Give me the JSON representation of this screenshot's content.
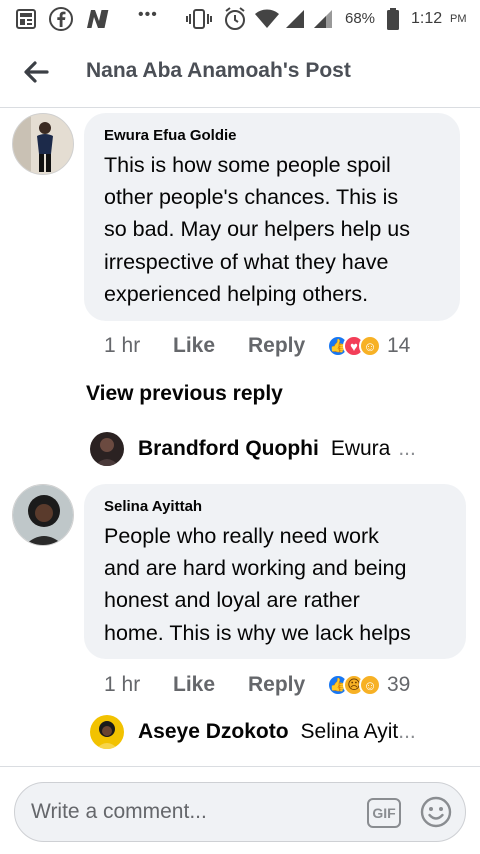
{
  "status_bar": {
    "battery": "68%",
    "time": "1:12",
    "ampm": "PM",
    "dots": "•••"
  },
  "header": {
    "title": "Nana Aba Anamoah's Post"
  },
  "comments": [
    {
      "author": "Ewura Efua Goldie",
      "lines": [
        "This is how some people spoil",
        "other people's chances. This is",
        "so bad. May our helpers help us",
        "irrespective of what they have",
        "experienced helping others."
      ],
      "time": "1 hr",
      "like": "Like",
      "reply": "Reply",
      "reaction_count": "14",
      "reactions": [
        "like",
        "love",
        "care"
      ]
    },
    {
      "author": "Selina Ayittah",
      "lines": [
        "People who really need work",
        "and are hard working and being",
        "honest and loyal are rather",
        "home. This is why we lack helps"
      ],
      "time": "1 hr",
      "like": "Like",
      "reply": "Reply",
      "reaction_count": "39",
      "reactions": [
        "like",
        "sad",
        "care"
      ]
    }
  ],
  "view_previous": "View previous reply",
  "replies": [
    {
      "author": "Brandford Quophi",
      "preview": "Ewura",
      "ellipsis": "..."
    },
    {
      "author": "Aseye Dzokoto",
      "preview": "Selina Ayit",
      "ellipsis": "..."
    }
  ],
  "composer": {
    "placeholder": "Write a comment...",
    "gif_label": "GIF"
  },
  "colors": {
    "accent": "#1877f2",
    "love": "#f33e58",
    "care": "#f7b125",
    "bubble": "#f0f2f5",
    "secondary_text": "#65676b"
  }
}
